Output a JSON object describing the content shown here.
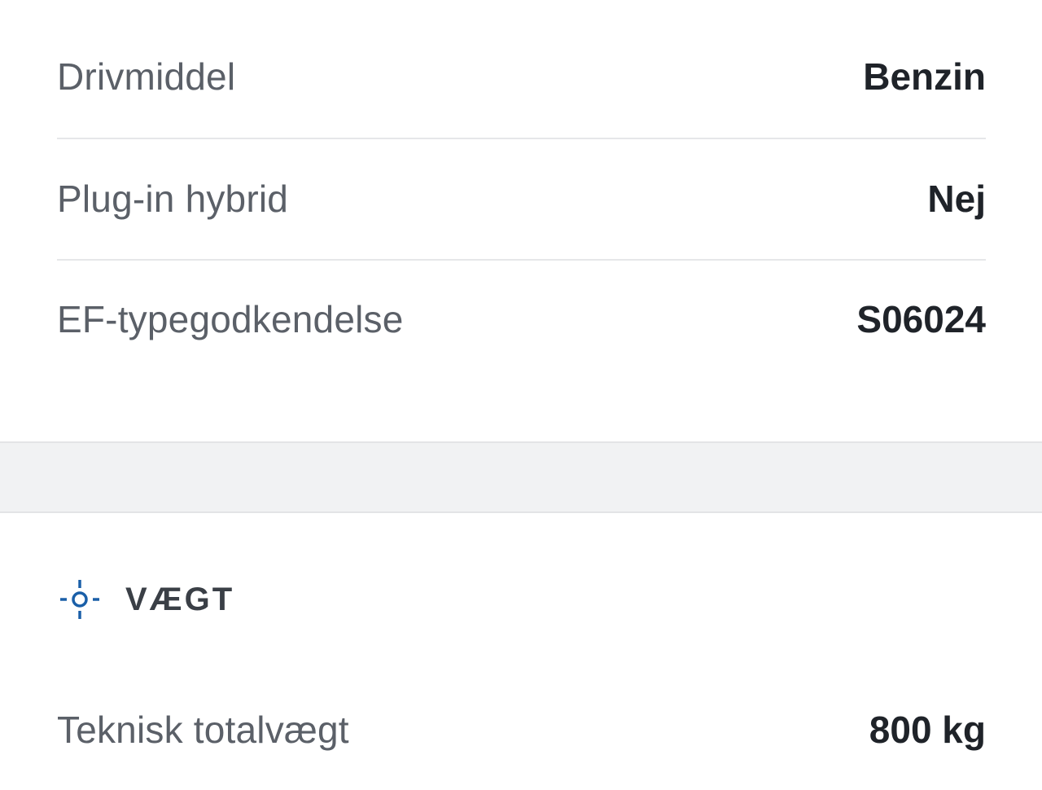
{
  "specs": {
    "rows": [
      {
        "label": "Drivmiddel",
        "value": "Benzin"
      },
      {
        "label": "Plug-in hybrid",
        "value": "Nej"
      },
      {
        "label": "EF-typegodkendelse",
        "value": "S06024"
      }
    ]
  },
  "weight_section": {
    "icon": "target-icon",
    "title": "VÆGT",
    "rows": [
      {
        "label": "Teknisk totalvægt",
        "value": "800 kg"
      }
    ]
  },
  "colors": {
    "label_text": "#5b6068",
    "value_text": "#1f2329",
    "icon_blue": "#1a5fa8",
    "divider": "#e6e7e9",
    "band": "#f1f2f3"
  }
}
